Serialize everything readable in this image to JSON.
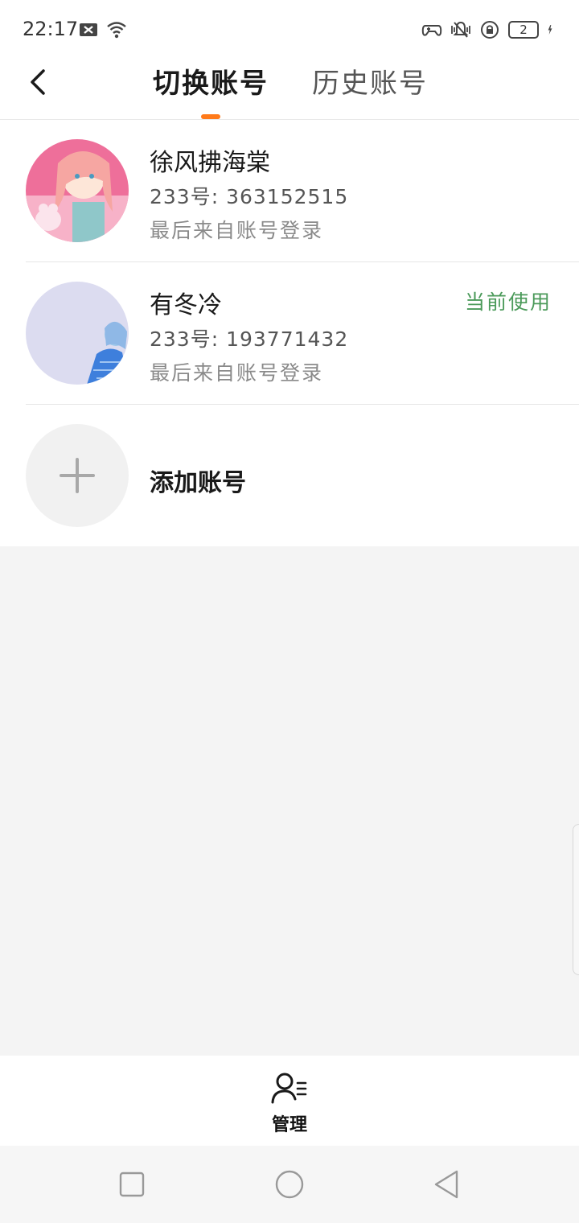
{
  "status_bar": {
    "time": "22:17",
    "left_icons": [
      "notification-x-icon",
      "wifi-icon"
    ],
    "right_icons": [
      "gamepad-icon",
      "vibrate-icon",
      "rotation-lock-icon"
    ],
    "battery_level": "2"
  },
  "header": {
    "back_icon": "chevron-left-icon",
    "tabs": [
      {
        "label": "切换账号",
        "active": true
      },
      {
        "label": "历史账号",
        "active": false
      }
    ],
    "indicator_color": "#ff7a1a"
  },
  "accounts": [
    {
      "name": "徐风拂海棠",
      "uid": "233号: 363152515",
      "login_source": "最后来自账号登录",
      "current": false
    },
    {
      "name": "有冬冷",
      "uid": "233号: 193771432",
      "login_source": "最后来自账号登录",
      "current": true,
      "current_label": "当前使用"
    }
  ],
  "add_account": {
    "label": "添加账号",
    "icon": "plus-icon"
  },
  "bottom_bar": {
    "manage_label": "管理",
    "manage_icon": "user-list-icon"
  },
  "system_nav": [
    "recent-apps-icon",
    "home-icon",
    "back-triangle-icon"
  ],
  "colors": {
    "accent": "#ff7a1a",
    "current_badge": "#4b9a5a",
    "background": "#f4f4f4"
  }
}
